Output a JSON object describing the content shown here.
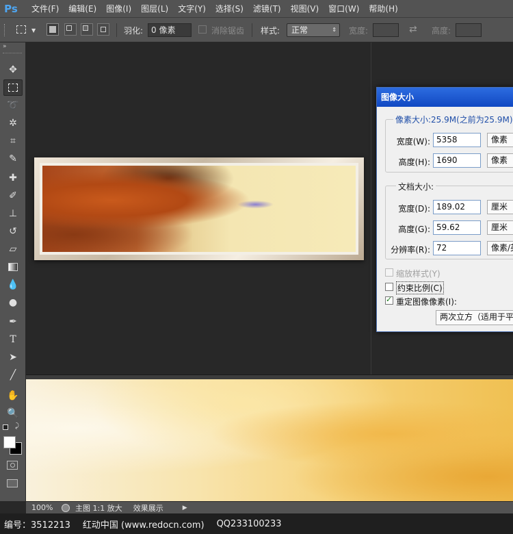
{
  "app": {
    "logo": "Ps"
  },
  "menu": [
    "文件(F)",
    "编辑(E)",
    "图像(I)",
    "图层(L)",
    "文字(Y)",
    "选择(S)",
    "滤镜(T)",
    "视图(V)",
    "窗口(W)",
    "帮助(H)"
  ],
  "options": {
    "feather_label": "羽化:",
    "feather_value": "0 像素",
    "antialias_label": "消除锯齿",
    "style_label": "样式:",
    "style_value": "正常",
    "width_label": "宽度:",
    "height_label": "高度:"
  },
  "dialog": {
    "title": "图像大小",
    "pixel_dims_legend": "像素大小:25.9M(之前为25.9M)",
    "pixel_width_label": "宽度(W):",
    "pixel_width_value": "5358",
    "pixel_width_unit": "像素",
    "pixel_height_label": "高度(H):",
    "pixel_height_value": "1690",
    "pixel_height_unit": "像素",
    "doc_size_legend": "文档大小:",
    "doc_width_label": "宽度(D):",
    "doc_width_value": "189.02",
    "doc_width_unit": "厘米",
    "doc_height_label": "高度(G):",
    "doc_height_value": "59.62",
    "doc_height_unit": "厘米",
    "resolution_label": "分辨率(R):",
    "resolution_value": "72",
    "resolution_unit": "像素/英",
    "scale_styles_label": "缩放样式(Y)",
    "constrain_label": "约束比例(C)",
    "resample_label": "重定图像像素(I):",
    "resample_method": "两次立方（适用于平"
  },
  "status": {
    "zoom": "100%",
    "text": "主图 1:1 放大",
    "text2": "效果展示"
  },
  "watermark": {
    "id": "编号：3512213",
    "site": "红动中国 (www.redocn.com)",
    "qq": "QQ233100233"
  }
}
